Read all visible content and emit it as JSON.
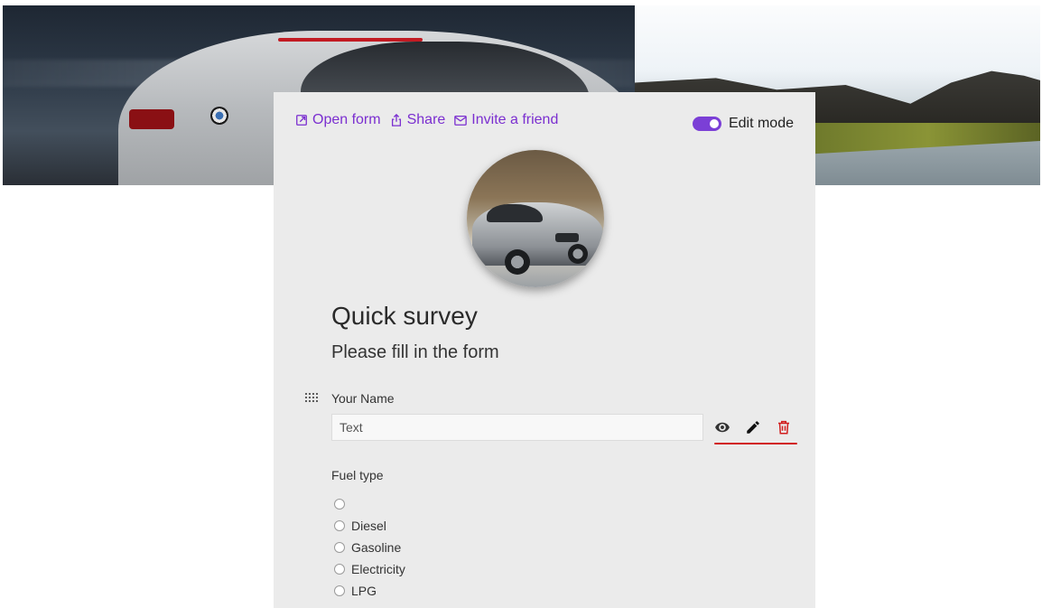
{
  "header_links": {
    "open_form": "Open form",
    "share": "Share",
    "invite": "Invite a friend"
  },
  "edit_mode": {
    "label": "Edit mode",
    "enabled": true,
    "color": "#7b3fd6"
  },
  "form": {
    "title": "Quick survey",
    "description": "Please fill in the form"
  },
  "questions": {
    "name": {
      "label": "Your Name",
      "placeholder": "Text"
    },
    "fuel": {
      "label": "Fuel type",
      "options": [
        "",
        "Diesel",
        "Gasoline",
        "Electricity",
        "LPG"
      ]
    }
  },
  "icons": {
    "open_form": "external-link-icon",
    "share": "share-icon",
    "invite": "mail-icon",
    "drag": "drag-handle-icon",
    "view": "eye-icon",
    "edit": "pencil-icon",
    "delete": "trash-icon"
  },
  "colors": {
    "accent": "#7b2fd0",
    "danger": "#d11d1d",
    "card_bg": "#ebebeb"
  }
}
